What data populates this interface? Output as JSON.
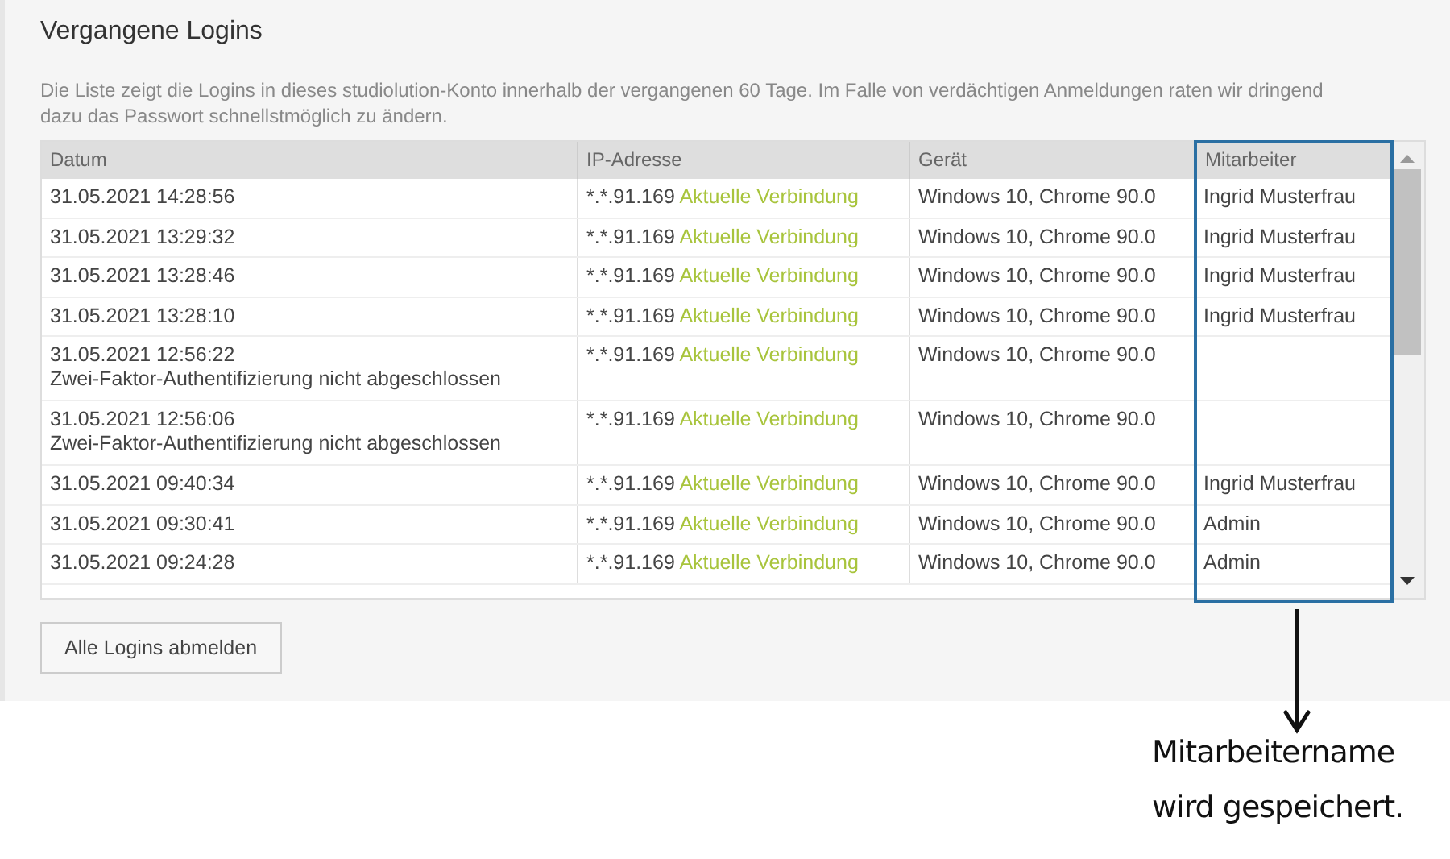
{
  "title": "Vergangene Logins",
  "description": "Die Liste zeigt die Logins in dieses studiolution-Konto innerhalb der vergangenen 60 Tage. Im Falle von verdächtigen Anmeldungen raten wir dringend dazu das Passwort schnellstmöglich zu ändern.",
  "table": {
    "columns": [
      "Datum",
      "IP-Adresse",
      "Gerät",
      "Mitarbeiter"
    ],
    "rows": [
      {
        "date": "31.05.2021 14:28:56",
        "note": "",
        "ip": "*.*.91.169",
        "connection": "Aktuelle Verbindung",
        "device": "Windows 10, Chrome 90.0",
        "employee": "Ingrid Musterfrau"
      },
      {
        "date": "31.05.2021 13:29:32",
        "note": "",
        "ip": "*.*.91.169",
        "connection": "Aktuelle Verbindung",
        "device": "Windows 10, Chrome 90.0",
        "employee": "Ingrid Musterfrau"
      },
      {
        "date": "31.05.2021 13:28:46",
        "note": "",
        "ip": "*.*.91.169",
        "connection": "Aktuelle Verbindung",
        "device": "Windows 10, Chrome 90.0",
        "employee": "Ingrid Musterfrau"
      },
      {
        "date": "31.05.2021 13:28:10",
        "note": "",
        "ip": "*.*.91.169",
        "connection": "Aktuelle Verbindung",
        "device": "Windows 10, Chrome 90.0",
        "employee": "Ingrid Musterfrau"
      },
      {
        "date": "31.05.2021 12:56:22",
        "note": "Zwei-Faktor-Authentifizierung nicht abgeschlossen",
        "ip": "*.*.91.169",
        "connection": "Aktuelle Verbindung",
        "device": "Windows 10, Chrome 90.0",
        "employee": ""
      },
      {
        "date": "31.05.2021 12:56:06",
        "note": "Zwei-Faktor-Authentifizierung nicht abgeschlossen",
        "ip": "*.*.91.169",
        "connection": "Aktuelle Verbindung",
        "device": "Windows 10, Chrome 90.0",
        "employee": ""
      },
      {
        "date": "31.05.2021 09:40:34",
        "note": "",
        "ip": "*.*.91.169",
        "connection": "Aktuelle Verbindung",
        "device": "Windows 10, Chrome 90.0",
        "employee": "Ingrid Musterfrau"
      },
      {
        "date": "31.05.2021 09:30:41",
        "note": "",
        "ip": "*.*.91.169",
        "connection": "Aktuelle Verbindung",
        "device": "Windows 10, Chrome 90.0",
        "employee": "Admin"
      },
      {
        "date": "31.05.2021 09:24:28",
        "note": "",
        "ip": "*.*.91.169",
        "connection": "Aktuelle Verbindung",
        "device": "Windows 10, Chrome 90.0",
        "employee": "Admin"
      }
    ]
  },
  "button": "Alle Logins abmelden",
  "annotation": {
    "lines": [
      "Mitarbeitername",
      "wird gespeichert."
    ]
  }
}
